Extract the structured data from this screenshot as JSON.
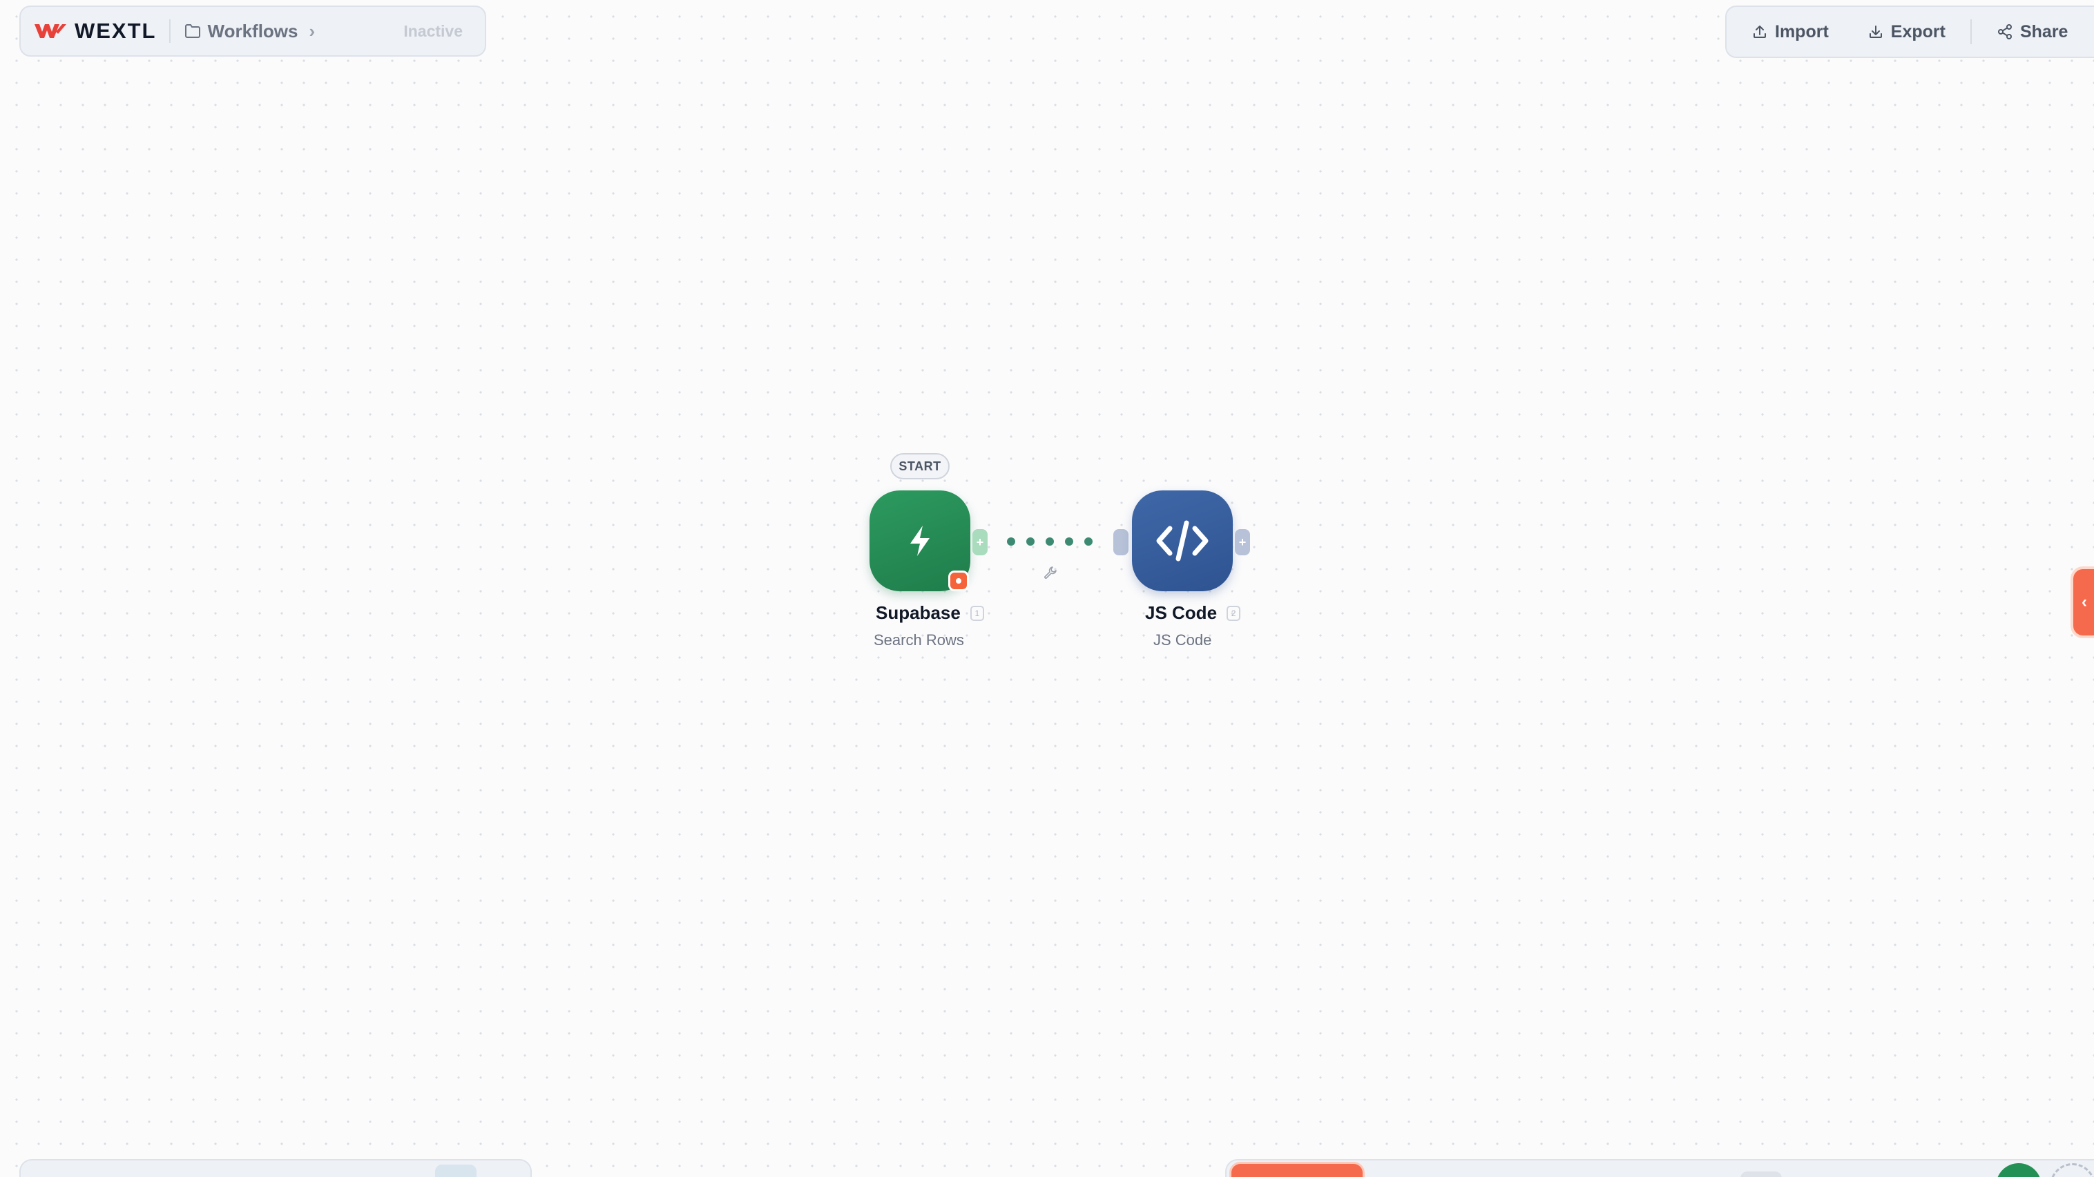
{
  "header": {
    "logo_text": "WEXTL",
    "breadcrumb_label": "Workflows",
    "status": "Inactive"
  },
  "toolbar": {
    "import_label": "Import",
    "export_label": "Export",
    "share_label": "Share"
  },
  "canvas": {
    "start_badge": "START",
    "nodes": [
      {
        "title": "Supabase",
        "subtitle": "Search Rows",
        "index": "1",
        "icon": "lightning-bolt-icon",
        "color": "#23955a"
      },
      {
        "title": "JS Code",
        "subtitle": "JS Code",
        "index": "2",
        "icon": "code-brackets-icon",
        "color": "#3a5f9e"
      }
    ],
    "handle_symbol": "+"
  },
  "side_panel": {
    "toggle_symbol": "‹"
  },
  "colors": {
    "accent": "#f56a4c",
    "brand_red": "#e8413a",
    "edge": "#3d8a73"
  }
}
